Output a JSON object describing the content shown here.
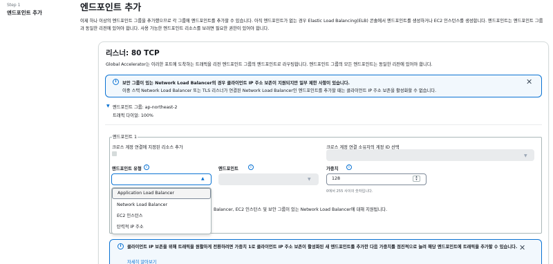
{
  "sidebar": {
    "step_label": "Step 1",
    "step_title": "엔드포인트 추가"
  },
  "header": {
    "title": "엔드포인트 추가",
    "description": "이제 하나 이상의 엔드포인트 그룹을 추가했으므로 각 그룹에 엔드포인트를 추가할 수 있습니다. 아직 엔드포인트가 없는 경우 Elastic Load Balancing(ELB) 콘솔에서 엔드포인트를 생성하거나 EC2 인스턴스를 생성합니다. 엔드포인트는 엔드포인트 그룹과 동일한 리전에 있어야 합니다. 사용 가능한 엔드포인트 리소스를 보려면 필요한 권한이 있어야 합니다."
  },
  "listener": {
    "title": "리스너: 80 TCP",
    "description": "Global Accelerator는 이러한 포트에 도착하는 트래픽을 리전 엔드포인트 그룹의 엔드포인트로 라우팅합니다. 엔드포인트 그룹의 모든 엔드포인트는 동일한 리전에 있어야 합니다.",
    "alert": {
      "title": "보안 그룹이 있는 Network Load Balancer의 경우 클라이언트 IP 주소 보존이 지원되지만 일부 제한 사항이 있습니다.",
      "body": "이중 스택 Network Load Balancer 또는 TLS 리스너가 연결된 Network Load Balancer인 엔드포인트를 추가할 때는 클라이언트 IP 주소 보존을 활성화할 수 없습니다.",
      "close_icon": "close-icon"
    },
    "endpoint_group": {
      "label": "엔드포인트 그룹: ap-northeast-2",
      "traffic_dial": "트래픽 다이얼: 100%"
    }
  },
  "endpoint": {
    "legend": "엔드포인트 1",
    "cross_account_label": "크로스 계정 연결에 지정된 리소스 추가",
    "cross_account_owner_label": "크로스 계정 연결 소유자의 계정 ID 선택",
    "endpoint_type_label": "엔드포인트 유형",
    "endpoint_label": "엔드포인트",
    "weight_label": "가중치",
    "info_icon": "i",
    "weight_value": "128",
    "weight_help": "0에서 255 사이의 숫자입니다.",
    "endpoint_type_options": [
      "Application Load Balancer",
      "Network Load Balancer",
      "EC2 인스턴스",
      "탄력적 IP 주소"
    ],
    "support_text": "Balancer, EC2 인스턴스 및 보안 그룹이 있는 Network Load Balancer에 대해 지원됩니다."
  },
  "bottom_alert": {
    "text": "클라이언트 IP 보존을 위해 트래픽을 원활하게 전환하려면 가중치 1로 클라이언트 IP 주소 보존이 활성화된 새 엔드포인트를 추가한 다음 가중치를 점진적으로 늘려 해당 엔드포인트에 트래픽을 추가할 수 있습니다.",
    "link": "자세히 알아보기"
  },
  "colors": {
    "accent": "#0972d3",
    "text": "#16191f",
    "muted": "#687078",
    "alert_bg": "#f2f8fd"
  }
}
